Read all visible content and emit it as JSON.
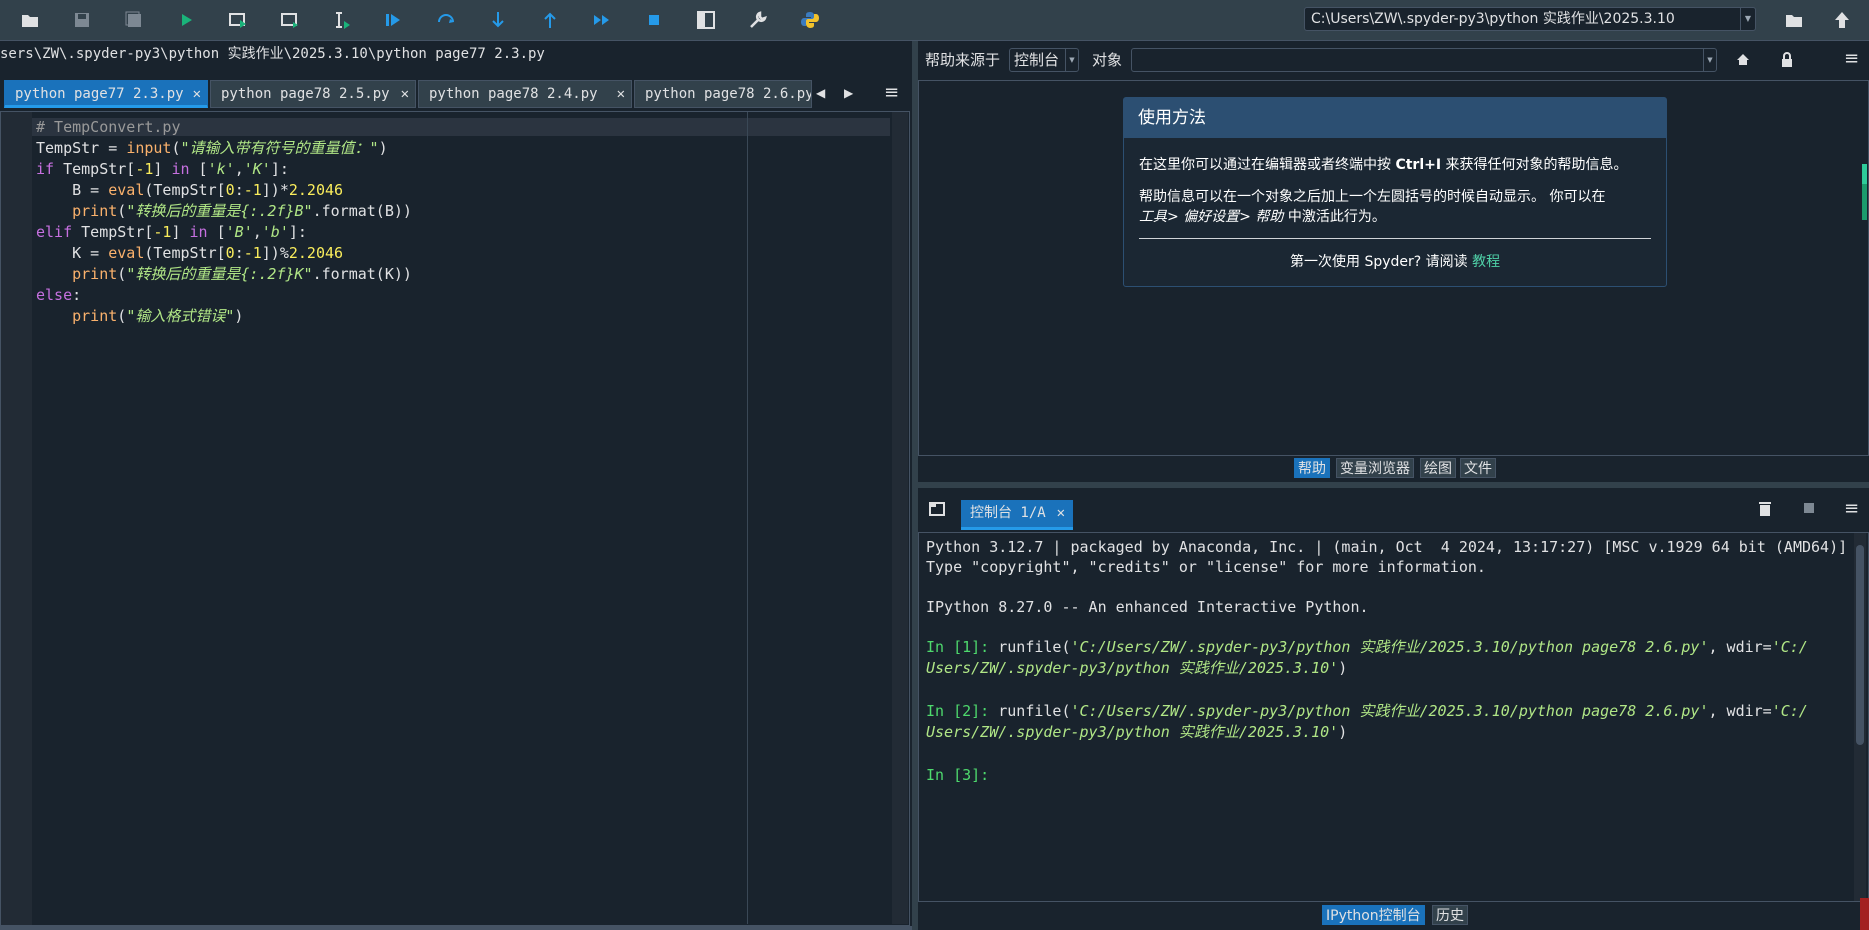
{
  "toolbar": {
    "path_value": "C:\\Users\\ZW\\.spyder-py3\\python 实践作业\\2025.3.10",
    "icons": [
      "open-file-icon",
      "save-icon",
      "save-all-icon",
      "run-icon",
      "run-cell-icon",
      "run-cell-advance-icon",
      "run-selection-icon",
      "debug-icon",
      "step-icon",
      "step-into-icon",
      "step-return-icon",
      "continue-icon",
      "stop-icon",
      "maximize-pane-icon",
      "preferences-icon",
      "python-path-icon",
      "browse-directory-icon",
      "parent-directory-icon"
    ]
  },
  "editor": {
    "file_path": "sers\\ZW\\.spyder-py3\\python 实践作业\\2025.3.10\\python page77  2.3.py",
    "tabs": [
      {
        "label": "python page77  2.3.py"
      },
      {
        "label": "python  page78 2.5.py"
      },
      {
        "label": "python  page78  2.4.py"
      },
      {
        "label": "python page78 2.6.py"
      }
    ],
    "close_glyph": "✕",
    "code": {
      "l1_comment": "# TempConvert.py",
      "l2_var": "TempStr",
      "l2_eq": " = ",
      "l2_fn": "input",
      "l2_open": "(",
      "l2_str": "\"请输入带有符号的重量值：\"",
      "l2_close": ")",
      "l3_if": "if",
      "l3_mid": " TempStr[",
      "l3_num": "-1",
      "l3_mid2": "] ",
      "l3_in": "in",
      "l3_open": " [",
      "l3_s1": "'k'",
      "l3_comma": ",",
      "l3_s2": "'K'",
      "l3_close": "]:",
      "l4_pre": "    B = ",
      "l4_fn": "eval",
      "l4_mid": "(TempStr[",
      "l4_n1": "0",
      "l4_colon": ":",
      "l4_n2": "-1",
      "l4_mid2": "])*",
      "l4_n3": "2.2046",
      "l5_pre": "    ",
      "l5_fn": "print",
      "l5_open": "(",
      "l5_str": "\"转换后的重量是{:.2f}B\"",
      "l5_rest": ".format(B))",
      "l6_elif": "elif",
      "l6_mid": " TempStr[",
      "l6_num": "-1",
      "l6_mid2": "] ",
      "l6_in": "in",
      "l6_open": " [",
      "l6_s1": "'B'",
      "l6_comma": ",",
      "l6_s2": "'b'",
      "l6_close": "]:",
      "l7_pre": "    K = ",
      "l7_fn": "eval",
      "l7_mid": "(TempStr[",
      "l7_n1": "0",
      "l7_colon": ":",
      "l7_n2": "-1",
      "l7_mid2": "])%",
      "l7_n3": "2.2046",
      "l8_pre": "    ",
      "l8_fn": "print",
      "l8_open": "(",
      "l8_str": "\"转换后的重量是{:.2f}K\"",
      "l8_rest": ".format(K))",
      "l9_else": "else",
      "l9_colon": ":",
      "l10_pre": "    ",
      "l10_fn": "print",
      "l10_open": "(",
      "l10_str": "\"输入格式错误\"",
      "l10_close": ")"
    }
  },
  "help": {
    "source_label": "帮助来源于",
    "source_value": "控制台",
    "object_label": "对象",
    "object_value": "",
    "card_title": "使用方法",
    "line1_a": "在这里你可以通过在编辑器或者终端中按 ",
    "line1_key": "Ctrl+I",
    "line1_b": " 来获得任何对象的帮助信息。",
    "line2": "帮助信息可以在一个对象之后加上一个左圆括号的时候自动显示。 你可以在",
    "line3_em": "工具> 偏好设置> 帮助",
    "line3_rest": " 中激活此行为。",
    "first_time": "第一次使用 Spyder? 请阅读 ",
    "tutorial_link": "教程",
    "tabs": [
      "帮助",
      "变量浏览器",
      "绘图",
      "文件"
    ]
  },
  "console": {
    "tab_label": "控制台 1/A",
    "line1": "Python 3.12.7 | packaged by Anaconda, Inc. | (main, Oct  4 2024, 13:17:27) [MSC v.1929 64 bit (AMD64)]",
    "line2": "Type \"copyright\", \"credits\" or \"license\" for more information.",
    "line3": "IPython 8.27.0 -- An enhanced Interactive Python.",
    "in1_prompt": "In [1]: ",
    "in2_prompt": "In [2]: ",
    "in3_prompt": "In [3]: ",
    "run_fn": "runfile(",
    "run_path": "'C:/Users/ZW/.spyder-py3/python 实践作业/2025.3.10/python page78 2.6.py'",
    "run_wdir_key": ", wdir=",
    "run_wdir_a": "'C:/",
    "run_wdir_b": "Users/ZW/.spyder-py3/python 实践作业/2025.3.10'",
    "run_close": ")",
    "tabs": [
      "IPython控制台",
      "历史"
    ]
  }
}
